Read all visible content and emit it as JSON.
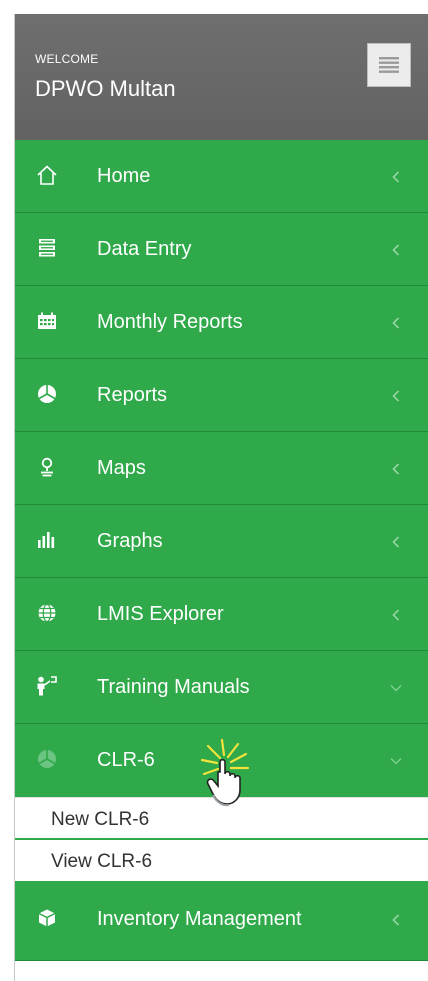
{
  "header": {
    "welcome": "WELCOME",
    "user": "DPWO Multan"
  },
  "menu": [
    {
      "label": "Home",
      "icon": "home-icon",
      "state": "collapsed"
    },
    {
      "label": "Data Entry",
      "icon": "database-icon",
      "state": "collapsed"
    },
    {
      "label": "Monthly Reports",
      "icon": "calendar-icon",
      "state": "collapsed"
    },
    {
      "label": "Reports",
      "icon": "pie-chart-icon",
      "state": "collapsed"
    },
    {
      "label": "Maps",
      "icon": "map-pin-icon",
      "state": "collapsed"
    },
    {
      "label": "Graphs",
      "icon": "bar-chart-icon",
      "state": "collapsed"
    },
    {
      "label": "LMIS Explorer",
      "icon": "globe-icon",
      "state": "collapsed"
    },
    {
      "label": "Training Manuals",
      "icon": "trainer-icon",
      "state": "expanded"
    },
    {
      "label": "CLR-6",
      "icon": "pie-chart-icon",
      "state": "expanded"
    },
    {
      "label": "Inventory Management",
      "icon": "box-icon",
      "state": "collapsed"
    }
  ],
  "submenu": [
    {
      "label": "New CLR-6"
    },
    {
      "label": "View CLR-6"
    }
  ],
  "colors": {
    "header_bg": "#666666",
    "menu_bg": "#2fa94a",
    "menu_divider": "#1f8a37",
    "submenu_bg": "#ffffff",
    "submenu_text": "#333333"
  }
}
